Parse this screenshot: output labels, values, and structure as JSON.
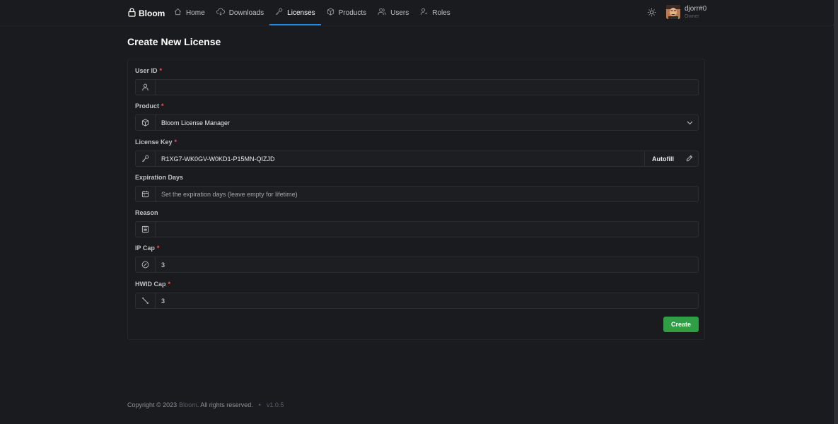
{
  "nav": {
    "brand": "Bloom",
    "items": [
      {
        "label": "Home",
        "icon": "home-icon"
      },
      {
        "label": "Downloads",
        "icon": "cloud-download-icon"
      },
      {
        "label": "Licenses",
        "icon": "key-icon",
        "active": true
      },
      {
        "label": "Products",
        "icon": "box-icon"
      },
      {
        "label": "Users",
        "icon": "users-icon"
      },
      {
        "label": "Roles",
        "icon": "user-role-icon"
      }
    ],
    "user": {
      "name": "djorr#0",
      "role": "Owner"
    }
  },
  "page": {
    "title": "Create New License"
  },
  "form": {
    "user_id": {
      "label": "User ID",
      "value": "",
      "placeholder": ""
    },
    "product": {
      "label": "Product",
      "value": "Bloom License Manager"
    },
    "license_key": {
      "label": "License Key",
      "value": "R1XG7-WK0GV-W0KD1-P15MN-QIZJD",
      "autofill": "Autofill"
    },
    "expiration": {
      "label": "Expiration Days",
      "placeholder": "Set the expiration days (leave empty for lifetime)"
    },
    "reason": {
      "label": "Reason",
      "value": ""
    },
    "ip_cap": {
      "label": "IP Cap",
      "value": "3"
    },
    "hwid_cap": {
      "label": "HWID Cap",
      "value": "3"
    },
    "submit": "Create"
  },
  "footer": {
    "copyright": "Copyright © 2023",
    "brand": "Bloom",
    "rights": ". All rights reserved.",
    "separator": "•",
    "version": "v1.0.5"
  },
  "colors": {
    "background": "#1a1b1e",
    "accent": "#228be6",
    "success": "#2f9e44",
    "required": "#fa5252"
  }
}
